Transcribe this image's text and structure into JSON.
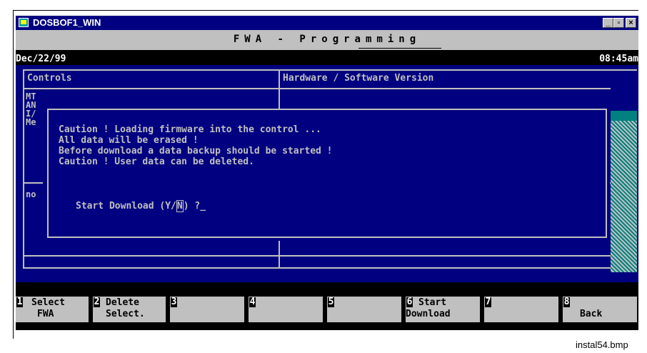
{
  "window": {
    "title": "DOSBOF1_WIN",
    "min_btn": "_",
    "max_btn": "▫",
    "close_btn": "×"
  },
  "app": {
    "title": "FWA - Programming"
  },
  "status": {
    "date": "Dec/22/99",
    "time": "08:45am"
  },
  "panels": {
    "left_header": "Controls",
    "right_header": "Hardware / Software Version",
    "left_rows": [
      "MT",
      "AN",
      "I/",
      "Me"
    ],
    "left_no": "no"
  },
  "dialog": {
    "lines": [
      "Caution ! Loading firmware into the control ...",
      "All data will be erased !",
      "Before download a data backup should be started !",
      "Caution ! User data can be deleted."
    ],
    "prompt": "Start Download (Y/",
    "prompt_default": "N",
    "prompt_end": ") ?",
    "cursor": "_"
  },
  "softkeys": [
    {
      "num": "1",
      "line1": "Select",
      "line2": "FWA"
    },
    {
      "num": "2",
      "line1": "Delete",
      "line2": "Select."
    },
    {
      "num": "3",
      "line1": "",
      "line2": ""
    },
    {
      "num": "4",
      "line1": "",
      "line2": ""
    },
    {
      "num": "5",
      "line1": "",
      "line2": ""
    },
    {
      "num": "6",
      "line1": "Start",
      "line2": "Download"
    },
    {
      "num": "7",
      "line1": "",
      "line2": ""
    },
    {
      "num": "8",
      "line1": "",
      "line2": "Back"
    }
  ],
  "caption": "instal54.bmp",
  "colors": {
    "screen_bg": "#000080",
    "text": "#c0c0c0",
    "accent": "#008080"
  }
}
